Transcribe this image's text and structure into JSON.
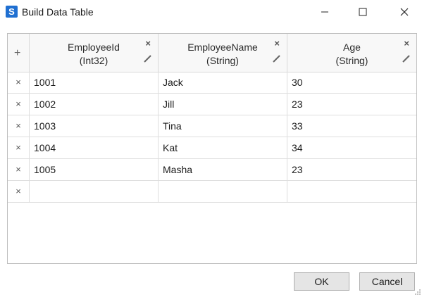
{
  "window": {
    "title": "Build Data Table",
    "icon_glyph": "S"
  },
  "grid": {
    "add_column_glyph": "+",
    "remove_glyph": "×",
    "columns": [
      {
        "name": "EmployeeId",
        "type": "(Int32)"
      },
      {
        "name": "EmployeeName",
        "type": "(String)"
      },
      {
        "name": "Age",
        "type": "(String)"
      }
    ],
    "rows": [
      {
        "id": "1001",
        "name": "Jack",
        "age": "30"
      },
      {
        "id": "1002",
        "name": "Jill",
        "age": "23"
      },
      {
        "id": "1003",
        "name": "Tina",
        "age": "33"
      },
      {
        "id": "1004",
        "name": "Kat",
        "age": "34"
      },
      {
        "id": "1005",
        "name": "Masha",
        "age": "23"
      },
      {
        "id": "",
        "name": "",
        "age": ""
      }
    ]
  },
  "buttons": {
    "ok": "OK",
    "cancel": "Cancel"
  },
  "colors": {
    "app_icon": "#1f6fd1",
    "button_face": "#e5e5e5",
    "grid_line": "#dedede"
  }
}
